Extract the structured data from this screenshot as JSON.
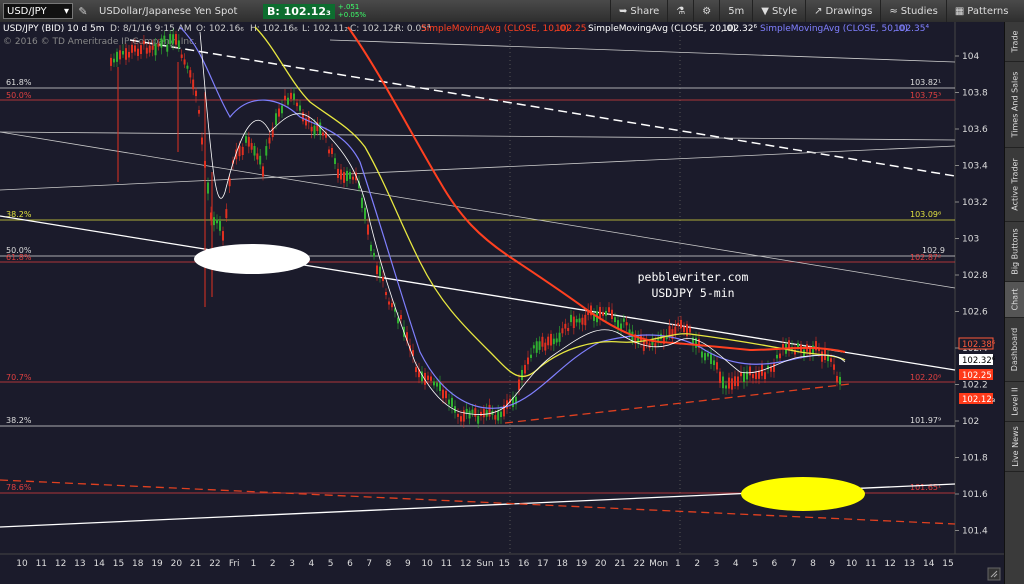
{
  "toolbar": {
    "symbol": "USD/JPY",
    "pencil_icon": "pencil-icon",
    "description": "USDollar/Japanese Yen Spot",
    "bid_label": "B: 102.12₃",
    "change_top": "+.051",
    "change_bottom": "+0.05%",
    "share_label": "Share",
    "flask_icon": "flask-icon",
    "gear_icon": "gear-icon",
    "interval_label": "5m",
    "style_label": "Style",
    "drawings_label": "Drawings",
    "studies_label": "Studies",
    "patterns_label": "Patterns"
  },
  "chart_header": {
    "title": "USD/JPY (BID) 10 d 5m",
    "d": "D: 8/1/16 9:15 AM",
    "o": "O: 102.16₆",
    "h": "H: 102.16₆",
    "l": "L: 102.11₂",
    "c": "C: 102.12₃",
    "r": "R: 0.05⁴",
    "sma10": "SimpleMovingAvg (CLOSE, 10, 0)",
    "sma10_val": "102.25",
    "sma20": "SimpleMovingAvg (CLOSE, 20, 0)",
    "sma20_val": "102.32⁶",
    "sma50": "SimpleMovingAvg (CLOSE, 50, 0)",
    "sma50_val": "102.35⁴",
    "copyright": "© 2016 © TD Ameritrade IP Company, Inc."
  },
  "watermark": {
    "line1": "pebblewriter.com",
    "line2": "USDJPY 5-min"
  },
  "fib_levels": [
    {
      "label": "61.8%",
      "value": "103.82¹",
      "color": "#dddddd"
    },
    {
      "label": "50.0%",
      "value": "103.75³",
      "color": "#e04040"
    },
    {
      "label": "38.2%",
      "value": "103.09⁶",
      "color": "#e0e040"
    },
    {
      "label": "50.0%",
      "value": "102.9",
      "color": "#dddddd"
    },
    {
      "label": "61.8%",
      "value": "102.87²",
      "color": "#e04040"
    },
    {
      "label": "70.7%",
      "value": "102.20⁶",
      "color": "#e04040"
    },
    {
      "label": "38.2%",
      "value": "101.97⁹",
      "color": "#dddddd"
    },
    {
      "label": "78.6%",
      "value": "101.65¹",
      "color": "#e04040"
    }
  ],
  "price_badges": [
    {
      "value": "102.38⁶",
      "bg": "#1b1b2b",
      "fg": "#ff5a3a",
      "border": "#ff5a3a"
    },
    {
      "value": "102.32⁶",
      "bg": "#ffffff",
      "fg": "#000000",
      "border": "#ffffff"
    },
    {
      "value": "102.25",
      "bg": "#ff3a1a",
      "fg": "#ffffff",
      "border": "#ff3a1a"
    },
    {
      "value": "102.12₃",
      "bg": "#ff3a1a",
      "fg": "#ffffff",
      "border": "#ff3a1a"
    }
  ],
  "y_ticks": [
    "104",
    "103.8",
    "103.6",
    "103.4",
    "103.2",
    "103",
    "102.8",
    "102.6",
    "102.4",
    "102.2",
    "102",
    "101.8",
    "101.6",
    "101.4"
  ],
  "x_ticks": [
    "10",
    "11",
    "12",
    "13",
    "14",
    "15",
    "18",
    "19",
    "20",
    "21",
    "22",
    "Fri",
    "1",
    "2",
    "3",
    "4",
    "5",
    "6",
    "7",
    "8",
    "9",
    "10",
    "11",
    "12",
    "Sun",
    "15",
    "16",
    "17",
    "18",
    "19",
    "20",
    "21",
    "22",
    "Mon",
    "1",
    "2",
    "3",
    "4",
    "5",
    "6",
    "7",
    "8",
    "9",
    "10",
    "11",
    "12",
    "13",
    "14",
    "15"
  ],
  "sidebar_tabs": [
    "Trade",
    "Times And Sales",
    "Active Trader",
    "Big Buttons",
    "Chart",
    "Dashboard",
    "Level II",
    "Live News"
  ],
  "colors": {
    "background": "#1b1b2b",
    "sma10": "#ff4020",
    "sma20": "#e8e840",
    "sma50": "#8080ff",
    "candle_up": "#30b030",
    "candle_down": "#e03020",
    "highlight_white": "#ffffff",
    "highlight_yellow": "#ffff00"
  }
}
